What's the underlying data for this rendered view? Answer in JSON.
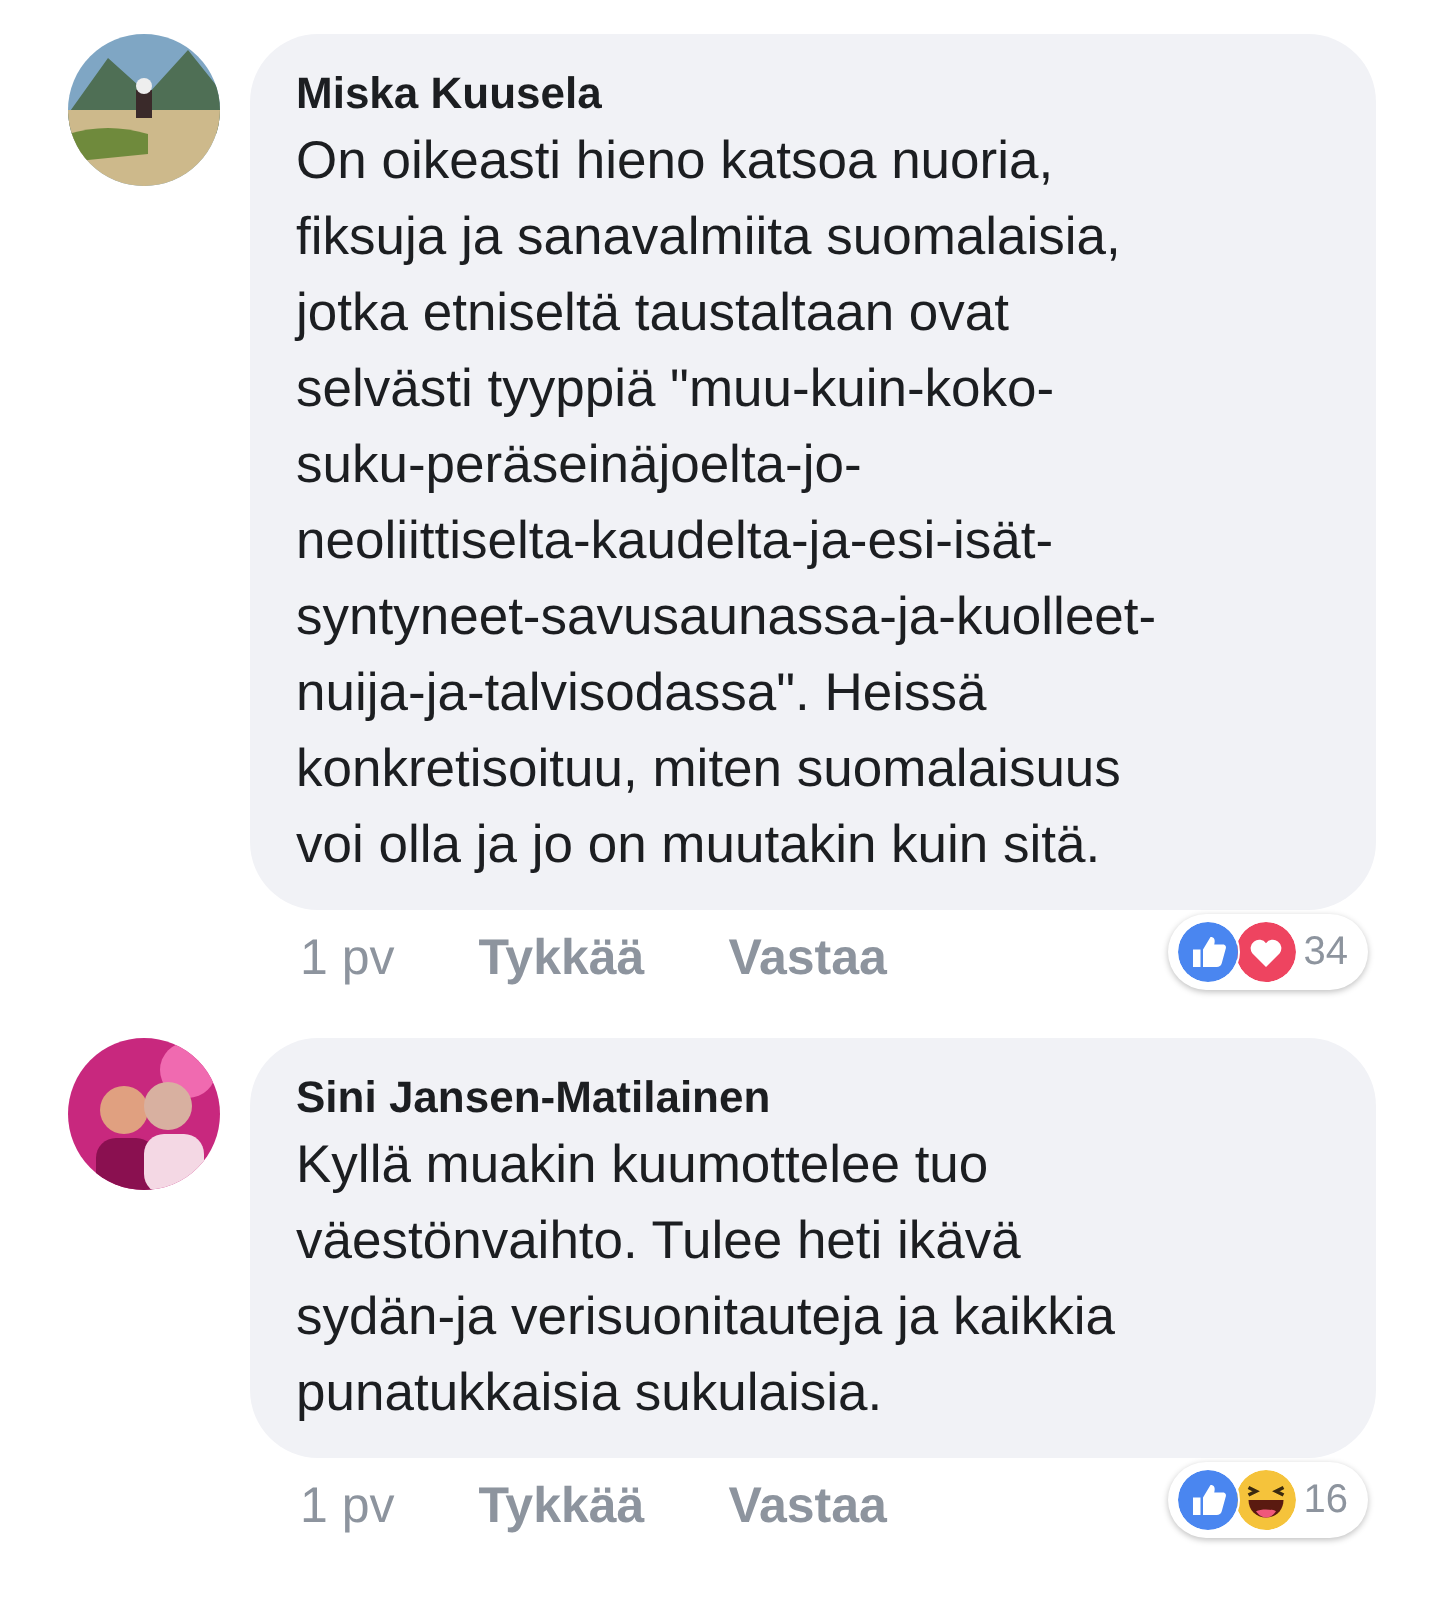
{
  "comments": [
    {
      "author": "Miska Kuusela",
      "text": "On oikeasti hieno katsoa nuoria,\nfiksuja ja sanavalmiita suomalaisia,\njotka etniseltä taustaltaan ovat\nselvästi tyyppiä \"muu-kuin-koko-\nsuku-peräseinäjoelta-jo-\nneoliittiselta-kaudelta-ja-esi-isät-\nsyntyneet-savusaunassa-ja-kuolleet-\nnuija-ja-talvisodassa\". Heissä\nkonkretisoituu, miten suomalaisuus\nvoi olla ja jo on muutakin kuin sitä.",
      "time": "1 pv",
      "like": "Tykkää",
      "reply": "Vastaa",
      "reactions": [
        {
          "kind": "like"
        },
        {
          "kind": "love"
        }
      ],
      "count": "34"
    },
    {
      "author": "Sini Jansen-Matilainen",
      "text": "Kyllä muakin kuumottelee tuo\nväestönvaihto. Tulee heti ikävä\nsydän-ja verisuonitauteja ja kaikkia\npunatukkaisia sukulaisia.",
      "time": "1 pv",
      "like": "Tykkää",
      "reply": "Vastaa",
      "reactions": [
        {
          "kind": "like"
        },
        {
          "kind": "haha"
        }
      ],
      "count": "16"
    }
  ]
}
